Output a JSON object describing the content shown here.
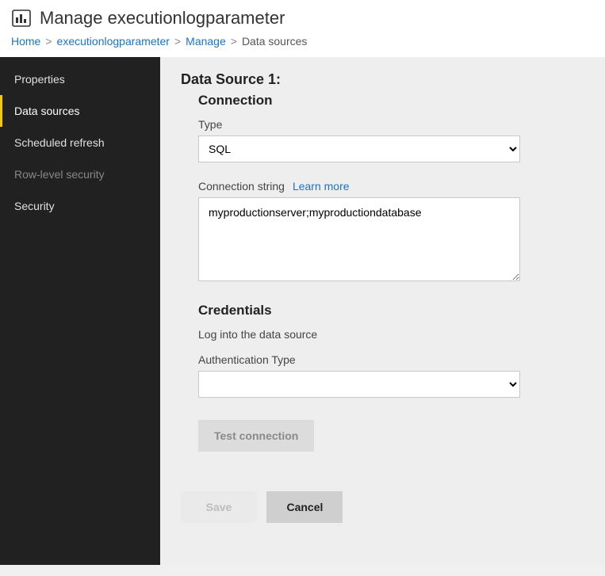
{
  "header": {
    "title": "Manage executionlogparameter"
  },
  "breadcrumb": {
    "home": "Home",
    "item": "executionlogparameter",
    "manage": "Manage",
    "current": "Data sources",
    "sep": ">"
  },
  "sidebar": {
    "items": [
      {
        "label": "Properties",
        "active": false,
        "dim": false
      },
      {
        "label": "Data sources",
        "active": true,
        "dim": false
      },
      {
        "label": "Scheduled refresh",
        "active": false,
        "dim": false
      },
      {
        "label": "Row-level security",
        "active": false,
        "dim": true
      },
      {
        "label": "Security",
        "active": false,
        "dim": false
      }
    ]
  },
  "main": {
    "ds_title": "Data Source 1:",
    "connection": {
      "header": "Connection",
      "type_label": "Type",
      "type_value": "SQL",
      "conn_label": "Connection string",
      "learn_more": "Learn more",
      "conn_value": "myproductionserver;myproductiondatabase"
    },
    "credentials": {
      "header": "Credentials",
      "hint": "Log into the data source",
      "auth_label": "Authentication Type",
      "auth_value": "",
      "test_label": "Test connection"
    },
    "actions": {
      "save": "Save",
      "cancel": "Cancel"
    }
  }
}
